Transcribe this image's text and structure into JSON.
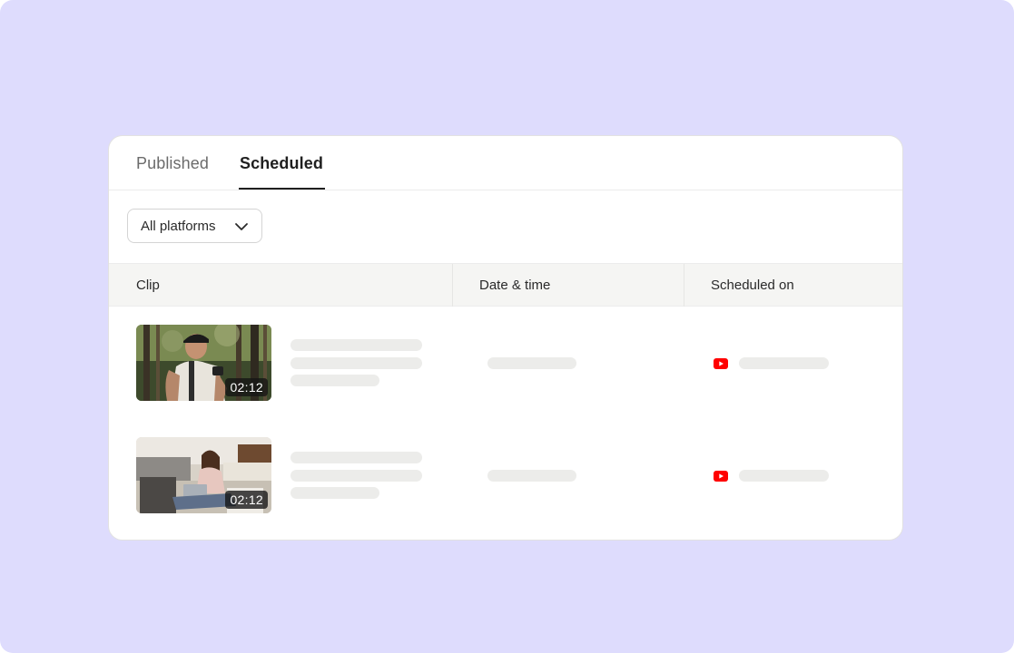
{
  "tabs": [
    {
      "label": "Published",
      "active": false
    },
    {
      "label": "Scheduled",
      "active": true
    }
  ],
  "filter": {
    "label": "All platforms",
    "icon": "chevron-down-icon"
  },
  "table": {
    "columns": [
      "Clip",
      "Date & time",
      "Scheduled on"
    ],
    "rows": [
      {
        "thumbnail": "man-with-camera-in-forest",
        "duration": "02:12",
        "platform_icon": "youtube-icon"
      },
      {
        "thumbnail": "woman-with-laptop-on-floor",
        "duration": "02:12",
        "platform_icon": "youtube-icon"
      }
    ]
  },
  "colors": {
    "background": "#dedcfd",
    "card": "#ffffff",
    "header_bg": "#f5f5f3",
    "skeleton": "#ececea",
    "youtube_red": "#ff0000",
    "text_primary": "#1f1f1f",
    "text_muted": "#6b6b6b"
  }
}
